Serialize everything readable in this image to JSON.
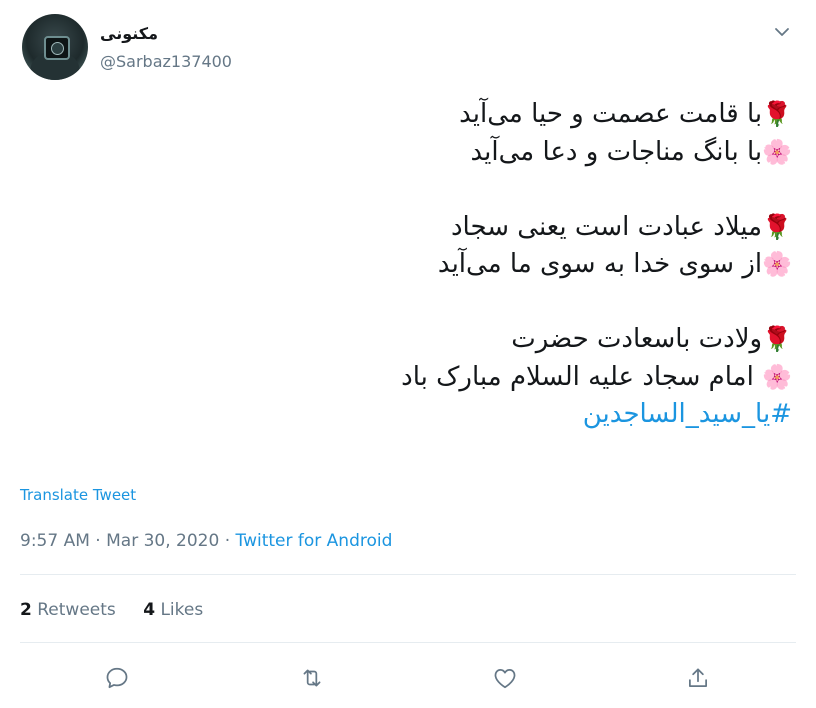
{
  "user": {
    "display_name": "مکنونی",
    "handle": "@Sarbaz137400"
  },
  "icons": {
    "menu": "chevron-down-icon",
    "reply": "reply-icon",
    "retweet": "retweet-icon",
    "like": "heart-icon",
    "share": "share-icon"
  },
  "tweet": {
    "lines": [
      {
        "emoji": "🌹",
        "text": "با قامت عصمت و حیا می‌آید"
      },
      {
        "emoji": "🌸",
        "text": "با بانگ مناجات و دعا می‌آید"
      },
      {
        "emoji": "🌹",
        "text": "میلاد عبادت است یعنی سجاد"
      },
      {
        "emoji": "🌸",
        "text": "از سوی خدا به سوی ما می‌آید"
      },
      {
        "emoji": "🌹",
        "text": "ولادت باسعادت حضرت"
      },
      {
        "emoji": "🌸",
        "text": " امام سجاد علیه السلام مبارک باد"
      }
    ],
    "hashtag": "#یا_سید_الساجدین"
  },
  "translate_label": "Translate Tweet",
  "meta": {
    "time": "9:57 AM",
    "date": "Mar 30, 2020",
    "separator": " · ",
    "source": "Twitter for Android"
  },
  "stats": {
    "retweets_count": "2",
    "retweets_label": "Retweets",
    "likes_count": "4",
    "likes_label": "Likes"
  },
  "colors": {
    "accent": "#1b95e0",
    "text": "#14171a",
    "secondary": "#657786",
    "divider": "#e6ecf0"
  }
}
